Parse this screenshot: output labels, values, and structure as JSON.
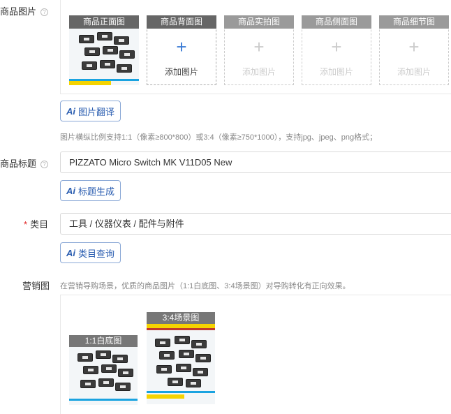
{
  "product_images": {
    "label": "商品图片",
    "help": "?",
    "slots": [
      {
        "title": "商品正面图",
        "state": "filled"
      },
      {
        "title": "商品背面图",
        "state": "active",
        "add_label": "添加图片"
      },
      {
        "title": "商品实拍图",
        "state": "disabled",
        "add_label": "添加图片"
      },
      {
        "title": "商品侧面图",
        "state": "disabled",
        "add_label": "添加图片"
      },
      {
        "title": "商品细节图",
        "state": "disabled",
        "add_label": "添加图片"
      }
    ],
    "translate_button": "图片翻译",
    "hint": "图片横纵比例支持1:1（像素≥800*800）或3:4（像素≥750*1000），支持jpg、jpeg、png格式；"
  },
  "title_field": {
    "label": "商品标题",
    "help": "?",
    "value": "PIZZATO Micro Switch MK V11D05 New",
    "generate_button": "标题生成"
  },
  "category_field": {
    "required_mark": "*",
    "label": "类目",
    "value": "工具 / 仪器仪表 / 配件与附件",
    "query_button": "类目查询"
  },
  "marketing": {
    "label": "营销图",
    "hint": "在营销导购场景，优质的商品图片（1:1白底图、3:4场景图）对导购转化有正向效果。",
    "items": [
      {
        "title": "1:1白底图"
      },
      {
        "title": "3:4场景图"
      }
    ]
  },
  "ai_icon_text": "Ai",
  "plus_glyph": "+",
  "colors": {
    "ai_blue": "#2a5db0",
    "plus_blue": "#3a7bd5",
    "required_red": "#e02020",
    "banner_red": "#c0392b",
    "banner_yellow": "#f5d300",
    "banner_blue": "#1aa3e0"
  }
}
